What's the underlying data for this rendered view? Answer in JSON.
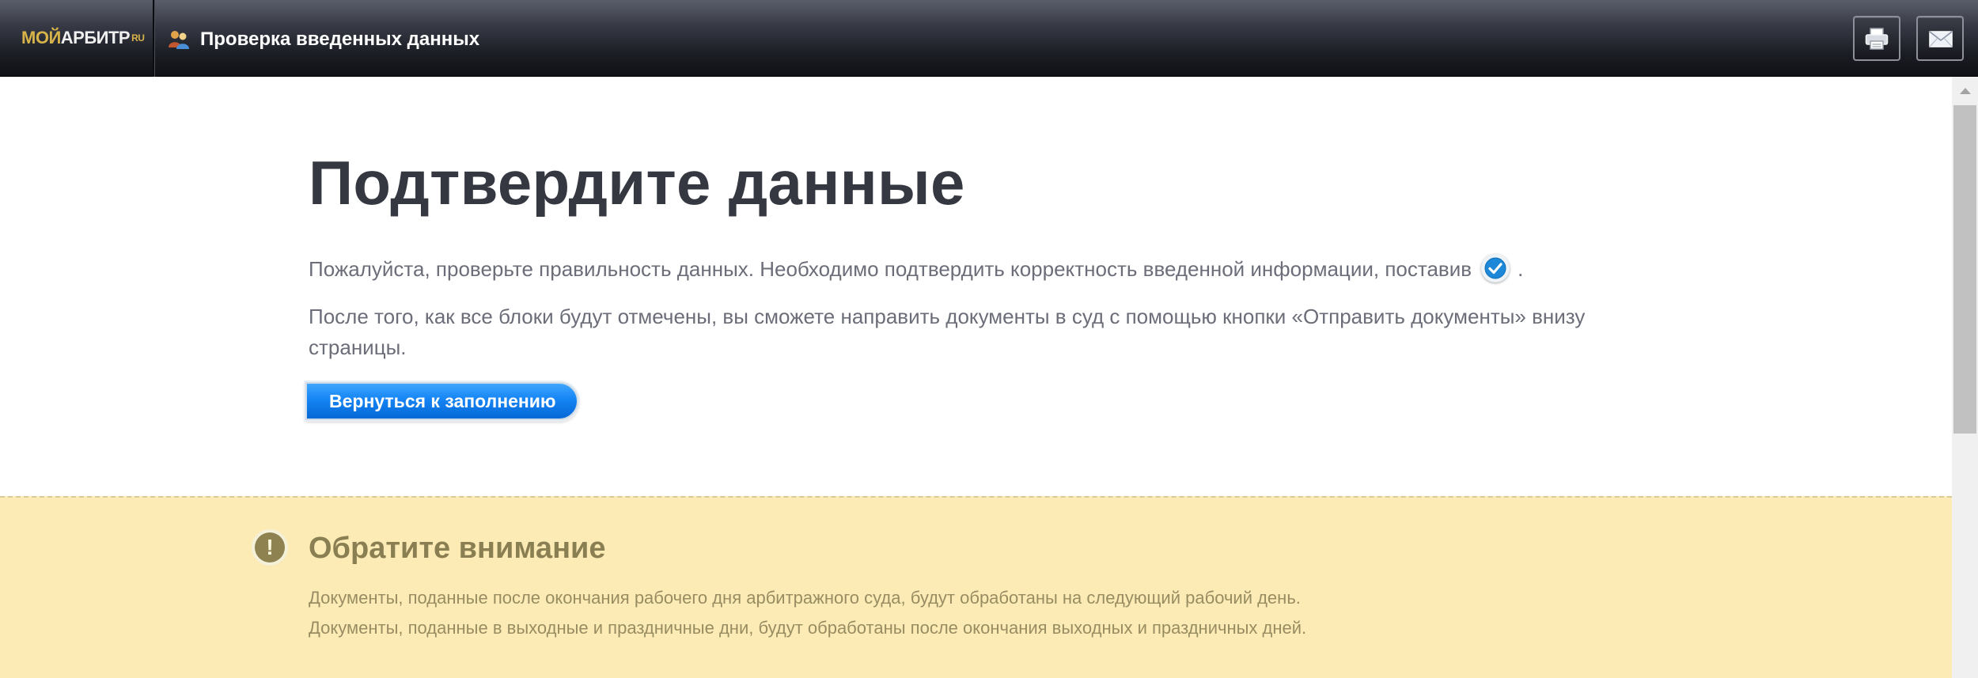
{
  "header": {
    "logo": {
      "moi": "МОЙ",
      "arbitr": "АРБИТР",
      "ru": "RU"
    },
    "title": "Проверка введенных данных",
    "title_icon": "users-icon",
    "actions": [
      {
        "name": "print-button",
        "icon": "printer-icon"
      },
      {
        "name": "mail-button",
        "icon": "envelope-icon"
      }
    ]
  },
  "main": {
    "heading": "Подтвердите данные",
    "paragraph1_before": "Пожалуйста, проверьте правильность данных. Необходимо подтвердить корректность введенной информации, поставив",
    "paragraph1_after": ".",
    "paragraph1_icon": "checkmark-icon",
    "paragraph2": "После того, как все блоки будут отмечены, вы сможете направить документы в суд с помощью кнопки «Отправить документы» внизу страницы.",
    "back_button": "Вернуться к заполнению"
  },
  "notice": {
    "icon": "exclamation-icon",
    "title": "Обратите внимание",
    "lines": [
      "Документы, поданные после окончания рабочего дня арбитражного суда, будут обработаны на следующий рабочий день.",
      "Документы, поданные в выходные и праздничные дни, будут обработаны после окончания выходных и праздничных дней."
    ]
  },
  "colors": {
    "accent_blue": "#1584f4",
    "notice_bg": "#fdebb5",
    "heading": "#353841",
    "logo_gold": "#d8b34a"
  }
}
